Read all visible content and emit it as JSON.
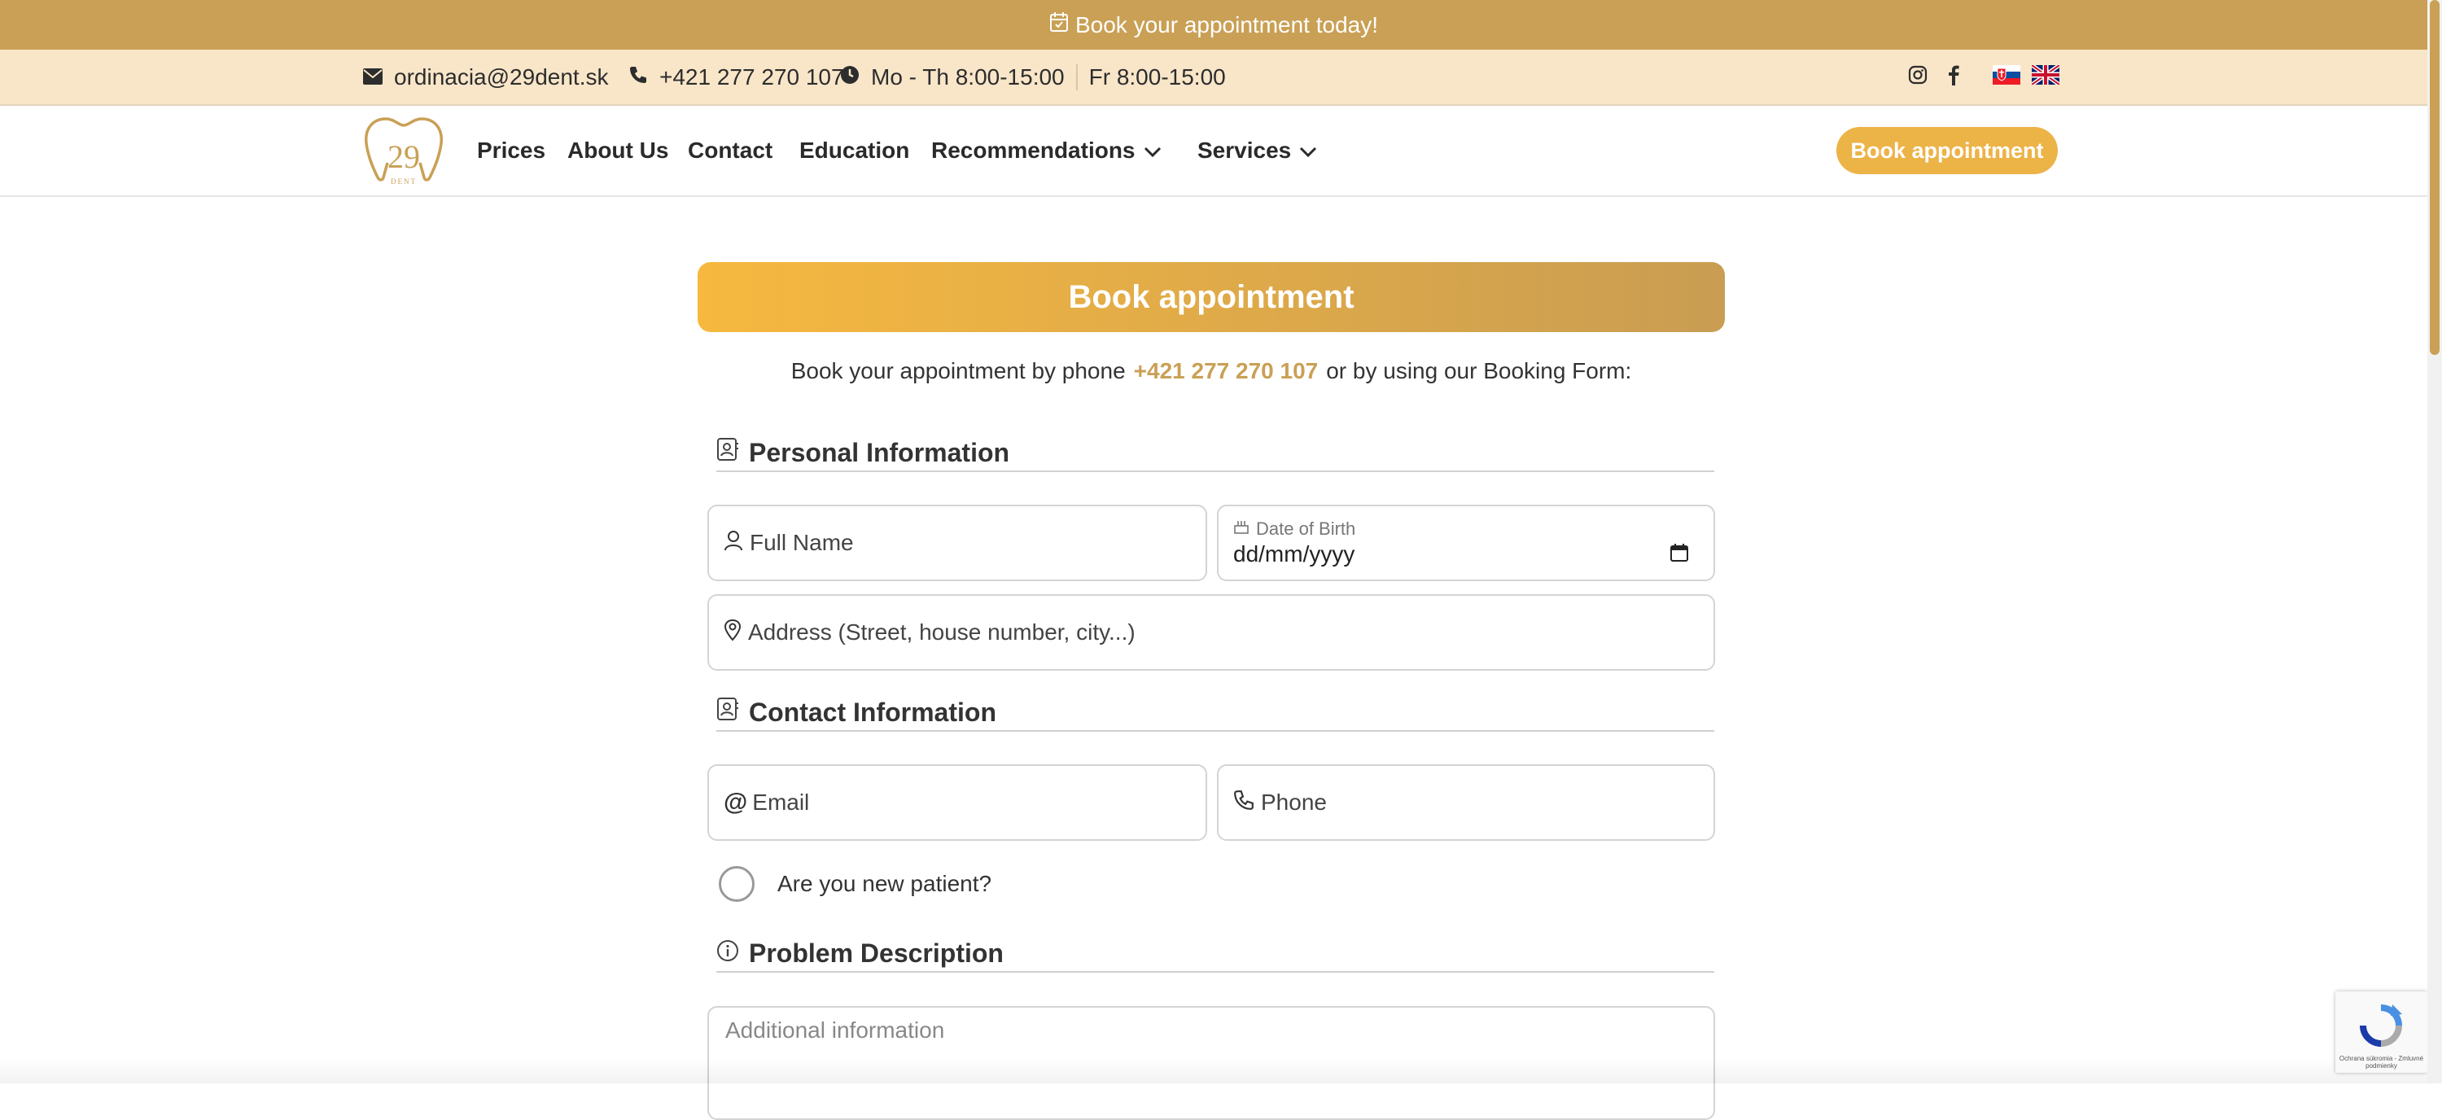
{
  "topbar": {
    "text": "Book your appointment today!"
  },
  "infobar": {
    "email": "ordinacia@29dent.sk",
    "phone": "+421 277 270 107",
    "hours_1": "Mo - Th 8:00-15:00",
    "hours_2": "Fr 8:00-15:00",
    "icons": [
      "envelope-icon",
      "phone-icon",
      "clock-icon",
      "instagram-icon",
      "facebook-icon",
      "slovak-flag-icon",
      "uk-flag-icon"
    ]
  },
  "nav": {
    "logo_text": "29",
    "logo_subtext": "DENT",
    "items": [
      {
        "label": "Prices"
      },
      {
        "label": "About Us"
      },
      {
        "label": "Contact"
      },
      {
        "label": "Education"
      },
      {
        "label": "Recommendations"
      },
      {
        "label": "Services"
      }
    ],
    "cta": "Book appointment"
  },
  "main": {
    "title": "Book appointment",
    "intro_before": "Book your appointment by phone",
    "intro_phone": "+421 277 270 107",
    "intro_after": "or by using our Booking Form:"
  },
  "form": {
    "personal_title": "Personal Information",
    "full_name_placeholder": "Full Name",
    "dob_label": "Date of Birth",
    "dob_value": "dd/mm/yyyy",
    "address_placeholder": "Address (Street, house number, city...)",
    "contact_title": "Contact Information",
    "email_placeholder": "Email",
    "phone_placeholder": "Phone",
    "new_patient_label": "Are you new patient?",
    "problem_title": "Problem Description",
    "additional_placeholder": "Additional information"
  },
  "recaptcha": {
    "text": "Ochrana súkromia - Zmluvné podmienky"
  },
  "colors": {
    "gold": "#c9a055",
    "cream": "#f9e6c9",
    "cta": "#ecb347"
  }
}
